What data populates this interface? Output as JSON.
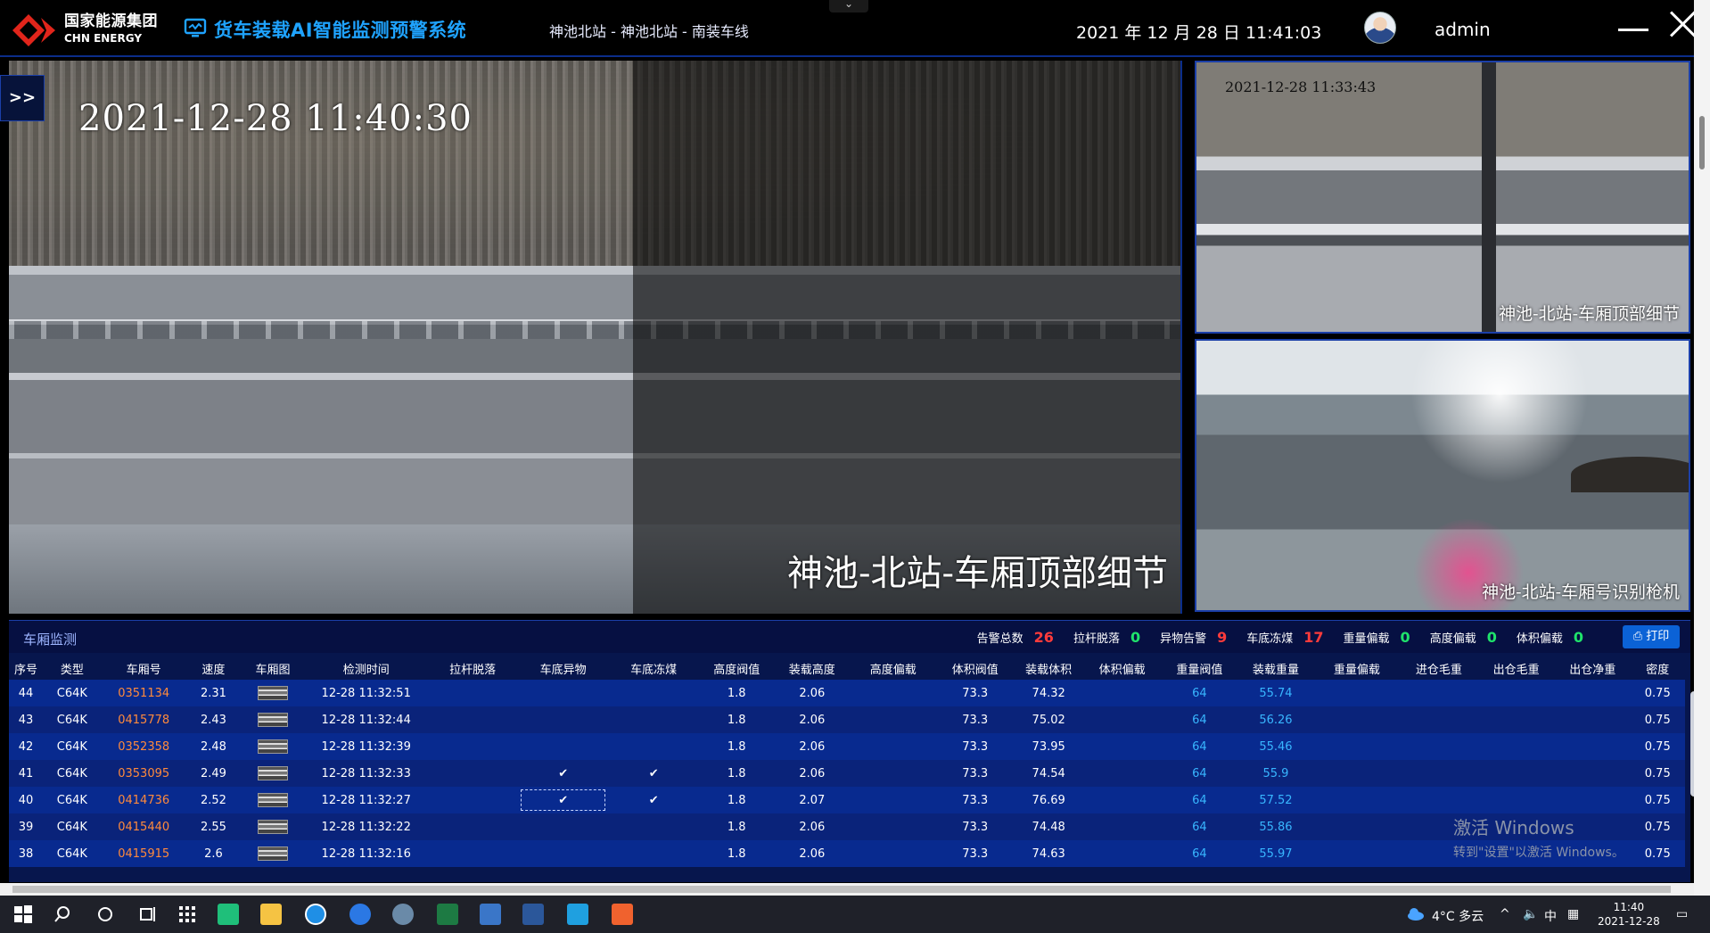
{
  "header": {
    "brand_cn": "国家能源集团",
    "brand_en": "CHN ENERGY",
    "system_title": "货车装载AI智能监测预警系统",
    "breadcrumb": "神池北站 - 神池北站 - 南装车线",
    "datetime": "2021 年 12 月 28 日 11:41:03",
    "username": "admin",
    "collapse_glyph": "⌄"
  },
  "colors": {
    "accent": "#1fa3ff",
    "alarm": "#ff3b3b",
    "ok": "#1fe36b",
    "carno": "#ff8a3c",
    "threshold": "#38b6ff"
  },
  "cameras": {
    "expand_label": ">>",
    "main": {
      "timestamp": "2021-12-28  11:40:30",
      "label": "神池-北站-车厢顶部细节"
    },
    "side_top": {
      "timestamp": "2021-12-28  11:33:43",
      "label": "神池-北站-车厢顶部细节"
    },
    "side_bottom": {
      "label": "神池-北站-车厢号识别枪机"
    }
  },
  "panel": {
    "title": "车厢监测",
    "print_label": "打印",
    "stats": [
      {
        "label": "告警总数",
        "value": "26",
        "tone": "red"
      },
      {
        "label": "拉杆脱落",
        "value": "0",
        "tone": "green"
      },
      {
        "label": "异物告警",
        "value": "9",
        "tone": "red"
      },
      {
        "label": "车底冻煤",
        "value": "17",
        "tone": "red"
      },
      {
        "label": "重量偏载",
        "value": "0",
        "tone": "green"
      },
      {
        "label": "高度偏载",
        "value": "0",
        "tone": "green"
      },
      {
        "label": "体积偏载",
        "value": "0",
        "tone": "green"
      }
    ],
    "columns": [
      "序号",
      "类型",
      "车厢号",
      "速度",
      "车厢图",
      "检测时间",
      "拉杆脱落",
      "车底异物",
      "车底冻煤",
      "高度阀值",
      "装载高度",
      "高度偏载",
      "体积阀值",
      "装载体积",
      "体积偏载",
      "重量阀值",
      "装载重量",
      "重量偏载",
      "进仓毛重",
      "出仓毛重",
      "出仓净重",
      "密度"
    ],
    "rows": [
      [
        "44",
        "C64K",
        "0351134",
        "2.31",
        "",
        "12-28 11:32:51",
        "",
        "",
        "",
        "1.8",
        "2.06",
        "",
        "73.3",
        "74.32",
        "",
        "64",
        "55.74",
        "",
        "",
        "",
        "",
        "0.75"
      ],
      [
        "43",
        "C64K",
        "0415778",
        "2.43",
        "",
        "12-28 11:32:44",
        "",
        "",
        "",
        "1.8",
        "2.06",
        "",
        "73.3",
        "75.02",
        "",
        "64",
        "56.26",
        "",
        "",
        "",
        "",
        "0.75"
      ],
      [
        "42",
        "C64K",
        "0352358",
        "2.48",
        "",
        "12-28 11:32:39",
        "",
        "",
        "",
        "1.8",
        "2.06",
        "",
        "73.3",
        "73.95",
        "",
        "64",
        "55.46",
        "",
        "",
        "",
        "",
        "0.75"
      ],
      [
        "41",
        "C64K",
        "0353095",
        "2.49",
        "",
        "12-28 11:32:33",
        "",
        "✔",
        "✔",
        "1.8",
        "2.06",
        "",
        "73.3",
        "74.54",
        "",
        "64",
        "55.9",
        "",
        "",
        "",
        "",
        "0.75"
      ],
      [
        "40",
        "C64K",
        "0414736",
        "2.52",
        "",
        "12-28 11:32:27",
        "",
        "✔",
        "✔",
        "1.8",
        "2.07",
        "",
        "73.3",
        "76.69",
        "",
        "64",
        "57.52",
        "",
        "",
        "",
        "",
        "0.75"
      ],
      [
        "39",
        "C64K",
        "0415440",
        "2.55",
        "",
        "12-28 11:32:22",
        "",
        "",
        "",
        "1.8",
        "2.06",
        "",
        "73.3",
        "74.48",
        "",
        "64",
        "55.86",
        "",
        "",
        "",
        "",
        "0.75"
      ],
      [
        "38",
        "C64K",
        "0415915",
        "2.6",
        "",
        "12-28 11:32:16",
        "",
        "",
        "",
        "1.8",
        "2.06",
        "",
        "73.3",
        "74.63",
        "",
        "64",
        "55.97",
        "",
        "",
        "",
        "",
        "0.75"
      ]
    ]
  },
  "watermark": {
    "line1": "激活 Windows",
    "line2": "转到\"设置\"以激活 Windows。"
  },
  "taskbar": {
    "weather": "4°C  多云",
    "ime": "中",
    "clock_time": "11:40",
    "clock_date": "2021-12-28",
    "icons": [
      "windows-start-icon",
      "search-icon",
      "cortana-icon",
      "task-view-icon",
      "apps-grid-icon",
      "mindmap-app-icon",
      "file-explorer-icon",
      "edge-icon",
      "ie-icon",
      "tool-app-icon",
      "excel-icon",
      "window-app-icon",
      "word-icon",
      "app-blue-icon",
      "app-orange-icon"
    ]
  }
}
